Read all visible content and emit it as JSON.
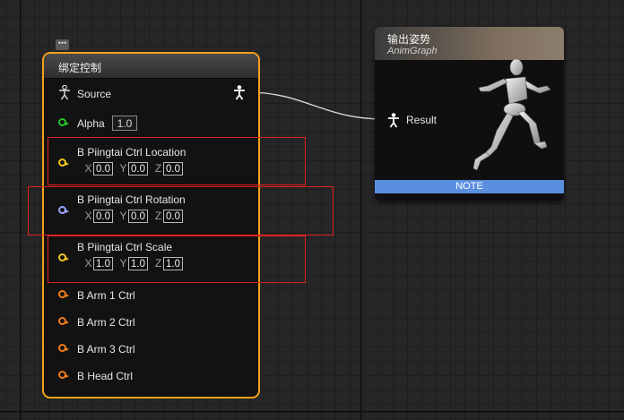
{
  "left_node": {
    "title": "绑定控制",
    "source_label": "Source",
    "alpha_label": "Alpha",
    "alpha_value": "1.0",
    "controls": [
      {
        "label": "B Piingtai Ctrl Location",
        "x": "0.0",
        "y": "0.0",
        "z": "0.0",
        "pin": "yellow"
      },
      {
        "label": "B Piingtai Ctrl Rotation",
        "x": "0.0",
        "y": "0.0",
        "z": "0.0",
        "pin": "blue"
      },
      {
        "label": "B Piingtai Ctrl Scale",
        "x": "1.0",
        "y": "1.0",
        "z": "1.0",
        "pin": "yellow"
      }
    ],
    "axis_labels": {
      "x": "X",
      "y": "Y",
      "z": "Z"
    },
    "bone_pins": [
      {
        "label": "B Arm 1 Ctrl"
      },
      {
        "label": "B Arm 2 Ctrl"
      },
      {
        "label": "B Arm 3 Ctrl"
      },
      {
        "label": "B Head Ctrl"
      }
    ]
  },
  "right_node": {
    "title": "输出姿势",
    "subtitle": "AnimGraph",
    "result_label": "Result",
    "note_label": "NOTE"
  },
  "colors": {
    "node_border": "#f1a21a",
    "highlight": "#e02020",
    "note_bar": "#5a8fe0",
    "exec_green": "#28c428",
    "vector_yellow": "#f2c41a",
    "rotator_blue": "#9aa8ff",
    "bone_orange": "#f07c1a"
  }
}
